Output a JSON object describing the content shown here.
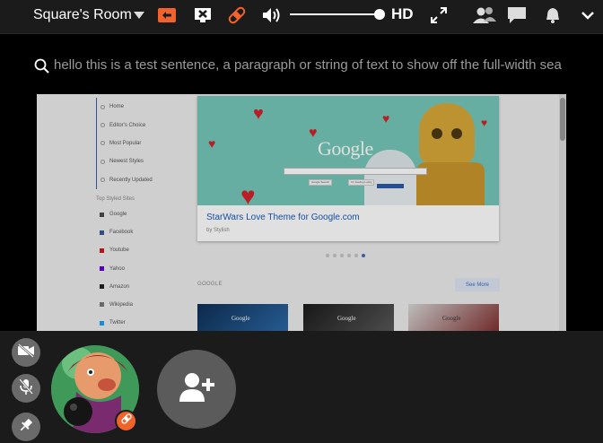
{
  "room": {
    "title": "Square's Room"
  },
  "toolbar": {
    "quality_label": "HD",
    "volume_level_percent": 100
  },
  "search": {
    "value": "hello this is a test sentence, a paragraph or string of text to show off the full-width sea"
  },
  "shared_screen": {
    "nav_items": [
      "Home",
      "Editor's Choice",
      "Most Popular",
      "Newest Styles",
      "Recently Updated"
    ],
    "sites_heading": "Top Styled Sites",
    "sites": [
      {
        "label": "Google",
        "color": "#4a4a4a"
      },
      {
        "label": "Facebook",
        "color": "#3b5998"
      },
      {
        "label": "Youtube",
        "color": "#cc181e"
      },
      {
        "label": "Yahoo",
        "color": "#5f01d1"
      },
      {
        "label": "Amazon",
        "color": "#222222"
      },
      {
        "label": "Wikipedia",
        "color": "#777777"
      },
      {
        "label": "Twitter",
        "color": "#1da1f2"
      }
    ],
    "banner": {
      "title": "StarWars Love Theme for Google.com",
      "author": "by Stylish",
      "logo_text": "Google",
      "btn_search": "Google Search",
      "btn_lucky": "I'm Feeling Lucky"
    },
    "carousel": {
      "count": 6,
      "active_index": 5
    },
    "section_label": "GOOGLE",
    "see_more": "See More",
    "thumb_text": "Google"
  },
  "colors": {
    "topbar_bg": "#1b1b1b",
    "badge_orange": "#f2622b",
    "screen_bg": "#ececec",
    "link_blue": "#1a5ab8"
  },
  "icons": [
    "orange-share-icon",
    "screen-off-icon",
    "bandaid-icon",
    "speaker-icon",
    "fullscreen-icon",
    "participants-icon",
    "chat-icon",
    "notification-bell-icon",
    "chevron-down-icon",
    "search-icon",
    "camera-off-icon",
    "mic-off-icon",
    "pin-icon",
    "add-person-icon"
  ]
}
